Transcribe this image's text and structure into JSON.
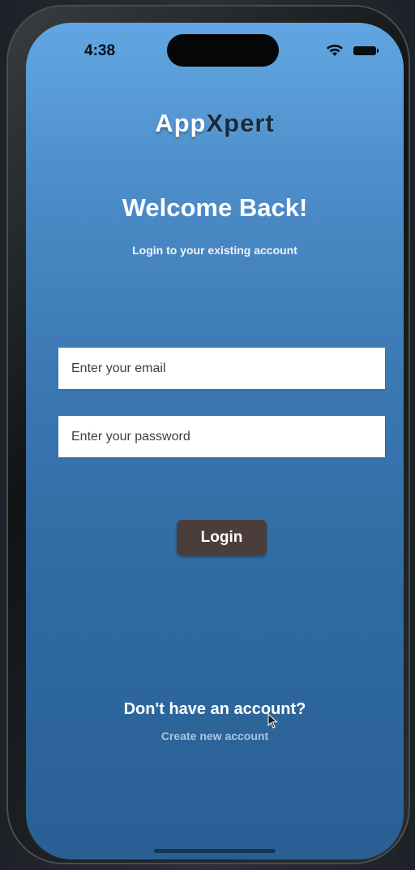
{
  "status_bar": {
    "time": "4:38",
    "signal_dots": "....",
    "icons": [
      "wifi-icon",
      "battery-icon"
    ]
  },
  "brand": {
    "part1": "App",
    "part2": "Xpert"
  },
  "heading": {
    "title": "Welcome Back!",
    "subtitle": "Login to your existing account"
  },
  "form": {
    "email_placeholder": "Enter your email",
    "email_value": "",
    "password_placeholder": "Enter your password",
    "password_value": "",
    "login_label": "Login"
  },
  "footer": {
    "prompt": "Don't have an account?",
    "create_link": "Create new account"
  },
  "colors": {
    "gradient_top": "#61a6e2",
    "gradient_bottom": "#2a5f94",
    "login_button": "#4a3d3a",
    "link": "#a9c7e6"
  }
}
